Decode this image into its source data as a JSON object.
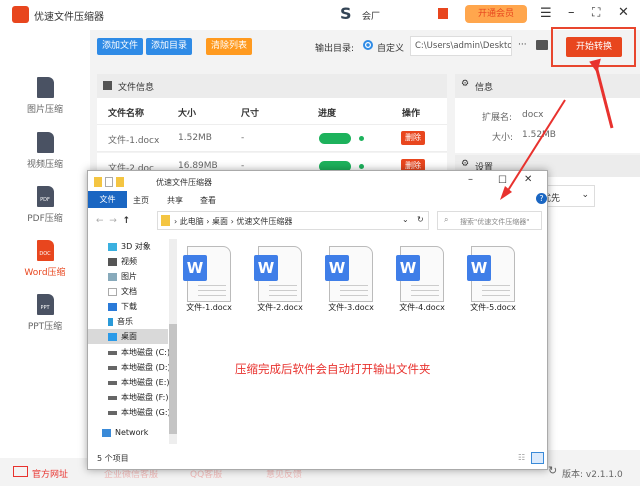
{
  "app": {
    "title": "优速文件压缩器",
    "user_partial": "会厂",
    "vip_label": "开通会员"
  },
  "toolbar": {
    "add_file": "添加文件",
    "add_dir": "添加目录",
    "clear_list": "清除列表",
    "output_label": "输出目录:",
    "custom_label": "自定义",
    "output_path": "C:\\Users\\admin\\Deskto",
    "more": "···",
    "start": "开始转换"
  },
  "sidebar": {
    "items": [
      {
        "label": "图片压缩",
        "icon": "image-file-icon"
      },
      {
        "label": "视频压缩",
        "icon": "video-file-icon"
      },
      {
        "label": "PDF压缩",
        "icon": "PDF"
      },
      {
        "label": "Word压缩",
        "icon": "DOC",
        "active": true
      },
      {
        "label": "PPT压缩",
        "icon": "PPT"
      }
    ]
  },
  "file_panel": {
    "title": "文件信息",
    "columns": [
      "文件名称",
      "大小",
      "尺寸",
      "进度",
      "操作"
    ],
    "rows": [
      {
        "name": "文件-1.docx",
        "size": "1.52MB",
        "dim": "-",
        "progress": 100,
        "action": "删除"
      },
      {
        "name": "文件-2.doc",
        "size": "16.89MB",
        "dim": "-",
        "progress": 100,
        "action": "删除"
      }
    ]
  },
  "info_panel": {
    "title": "信息",
    "ext_label": "扩展名:",
    "ext": "docx",
    "size_label": "大小:",
    "size": "1.52MB",
    "settings_title": "设置",
    "priority_partial": "优先"
  },
  "explorer": {
    "title": "优速文件压缩器",
    "tabs": [
      "文件",
      "主页",
      "共享",
      "查看"
    ],
    "breadcrumb": [
      "此电脑",
      "桌面",
      "优速文件压缩器"
    ],
    "search_placeholder": "搜索\"优速文件压缩器\"",
    "nav": [
      "3D 对象",
      "视频",
      "图片",
      "文档",
      "下载",
      "音乐",
      "桌面",
      "本地磁盘 (C:)",
      "本地磁盘 (D:)",
      "本地磁盘 (E:)",
      "本地磁盘 (F:)",
      "本地磁盘 (G:)",
      "Network"
    ],
    "files": [
      "文件-1.docx",
      "文件-2.docx",
      "文件-3.docx",
      "文件-4.docx",
      "文件-5.docx"
    ],
    "status": "5 个项目"
  },
  "annotation": "压缩完成后软件会自动打开输出文件夹",
  "footer": {
    "links": [
      "官方网址",
      "企业微信客服",
      "QQ客服",
      "意见反馈"
    ],
    "version": "版本: v2.1.1.0"
  },
  "colors": {
    "accent_red": "#e8461e",
    "blue": "#2f8be6",
    "orange": "#ff9a1f",
    "green": "#1db25c"
  }
}
